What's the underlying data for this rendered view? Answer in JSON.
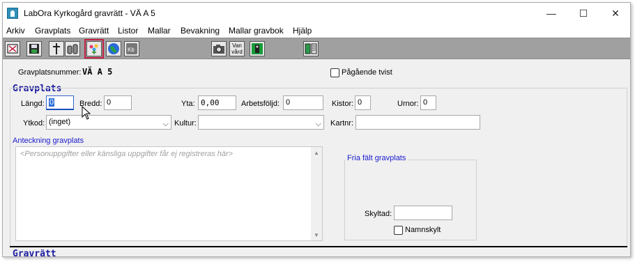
{
  "window": {
    "title": "LabOra Kyrkogård gravrätt - VÄ A  5",
    "minimize": "—",
    "maximize": "☐",
    "close": "✕"
  },
  "menu": [
    "Arkiv",
    "Gravplats",
    "Gravrätt",
    "Listor",
    "Mallar",
    "Bevakning",
    "Mallar gravbok",
    "Hjälp"
  ],
  "toolbar": {
    "icons": [
      "print-icon",
      "save-icon",
      "cross-icon",
      "graves-icon",
      "bouquet-icon",
      "globe-icon",
      "kb-icon",
      "camera-icon",
      "van-vard-icon",
      "door-icon",
      "book-icon"
    ],
    "van_vard_label": "Van\nvård",
    "kb_label": "Kb"
  },
  "header": {
    "gravplatsnummer_label": "Gravplatsnummer:",
    "gravplatsnummer_value": "VÄ A  5",
    "pagaende_tvist_label": "Pågående tvist"
  },
  "gravplats": {
    "heading": "Gravplats",
    "langd_label": "Längd:",
    "langd_value": "0",
    "bredd_label": "Bredd:",
    "bredd_value": "0",
    "yta_label": "Yta:",
    "yta_value": "0,00",
    "arbetsfoljd_label": "Arbetsföljd:",
    "arbetsfoljd_value": "0",
    "kistor_label": "Kistor:",
    "kistor_value": "0",
    "urnor_label": "Urnor:",
    "urnor_value": "0",
    "ytkod_label": "Ytkod:",
    "ytkod_value": "(inget)",
    "kultur_label": "Kultur:",
    "kultur_value": "",
    "kartnr_label": "Kartnr:",
    "kartnr_value": ""
  },
  "anteckning": {
    "legend": "Anteckning gravplats",
    "placeholder": "<Personuppgifter eller känsliga uppgifter får ej registreras här>"
  },
  "fria_falt": {
    "legend": "Fria fält gravplats",
    "skyltad_label": "Skyltad:",
    "skyltad_value": "",
    "namnskylt_label": "Namnskylt"
  },
  "gravratt": {
    "heading": "Gravrätt"
  }
}
